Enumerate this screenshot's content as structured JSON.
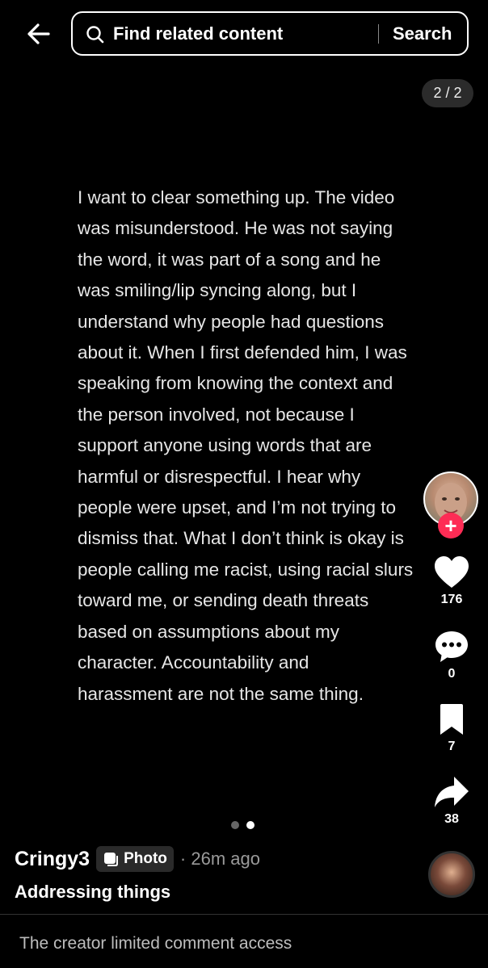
{
  "header": {
    "search_placeholder": "Find related content",
    "search_button": "Search"
  },
  "carousel": {
    "page_indicator": "2 / 2",
    "current": 2,
    "total": 2
  },
  "post": {
    "text": "I want to clear something up. The video\nwas misunderstood. He was not saying\nthe word, it was part of a song and he\nwas smiling/lip syncing along, but I\nunderstand why people had questions\nabout it. When I first defended him, I was\nspeaking from knowing the context and\nthe person involved, not because I\nsupport anyone using words that are\nharmful or disrespectful. I hear why\npeople were upset, and I’m not trying to\ndismiss that. What I don’t think is okay is\npeople calling me racist, using racial slurs\ntoward me, or sending death threats\nbased on assumptions about my\ncharacter. Accountability and\nharassment are not the same thing."
  },
  "actions": {
    "likes": "176",
    "comments": "0",
    "saves": "7",
    "shares": "38"
  },
  "creator": {
    "username": "Cringy3",
    "badge": "Photo",
    "timestamp": "· 26m ago",
    "caption": "Addressing things"
  },
  "comments": {
    "notice": "The creator limited comment access"
  },
  "colors": {
    "background": "#000000",
    "follow_accent": "#fe2c55",
    "text_primary": "#ffffff",
    "text_secondary": "#9a9a9a"
  }
}
